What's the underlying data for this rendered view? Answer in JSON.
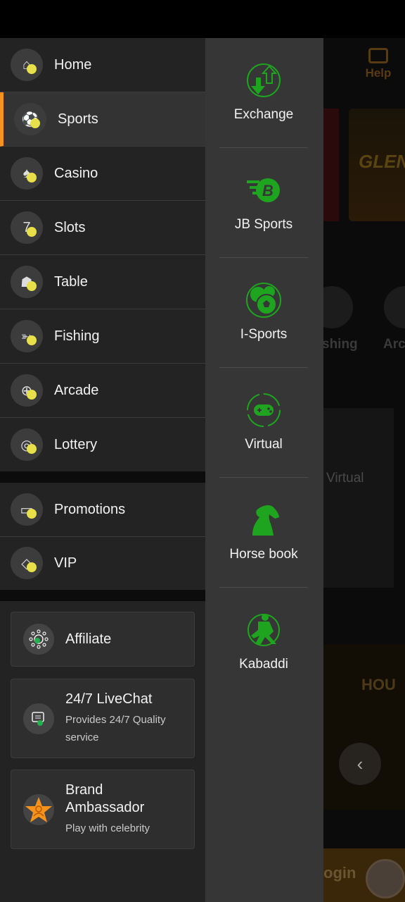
{
  "background": {
    "help_label": "Help",
    "fishing_partial": "shing",
    "arcade_partial": "Arc",
    "virtual_label": "Virtual",
    "login_partial": "ogin",
    "banner_text": "GLEN",
    "promo_text": "HOU"
  },
  "menu": {
    "items": [
      {
        "label": "Home",
        "icon": "home-icon"
      },
      {
        "label": "Sports",
        "icon": "sports-ball-icon",
        "selected": true
      },
      {
        "label": "Casino",
        "icon": "cards-icon"
      },
      {
        "label": "Slots",
        "icon": "slots-777-icon"
      },
      {
        "label": "Table",
        "icon": "table-game-icon"
      },
      {
        "label": "Fishing",
        "icon": "fish-icon"
      },
      {
        "label": "Arcade",
        "icon": "gamepad-icon"
      },
      {
        "label": "Lottery",
        "icon": "lottery-balls-icon"
      }
    ],
    "extra": [
      {
        "label": "Promotions",
        "icon": "ticket-icon"
      },
      {
        "label": "VIP",
        "icon": "diamond-icon"
      }
    ],
    "cards": [
      {
        "title": "Affiliate",
        "icon": "affiliate-network-icon"
      },
      {
        "title": "24/7 LiveChat",
        "subtitle": "Provides 24/7 Quality service",
        "icon": "chat-icon"
      },
      {
        "title": "Brand Ambassador",
        "subtitle": "Play with celebrity",
        "icon": "star-person-icon"
      }
    ]
  },
  "submenu": {
    "items": [
      {
        "label": "Exchange",
        "icon": "exchange-arrows-icon"
      },
      {
        "label": "JB Sports",
        "icon": "jb-sports-logo-icon"
      },
      {
        "label": "I-Sports",
        "icon": "multi-ball-icon"
      },
      {
        "label": "Virtual",
        "icon": "virtual-gamepad-icon"
      },
      {
        "label": "Horse book",
        "icon": "horse-head-icon"
      },
      {
        "label": "Kabaddi",
        "icon": "kabaddi-players-icon"
      }
    ]
  },
  "colors": {
    "accent": "#f7931a",
    "submenu_icon": "#1fa41f",
    "icon_dot": "#e8e04a"
  }
}
